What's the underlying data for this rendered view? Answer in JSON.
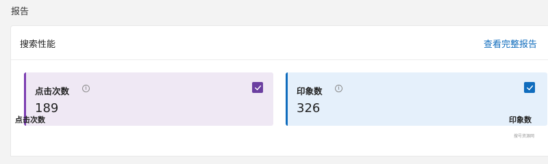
{
  "section": {
    "title": "报告"
  },
  "card": {
    "title": "搜索性能",
    "link_label": "查看完整报告"
  },
  "metrics": [
    {
      "label": "点击次数",
      "value": "189",
      "checked": true,
      "color": "#7a3bb0"
    },
    {
      "label": "印象数",
      "value": "326",
      "checked": true,
      "color": "#0f6cbd"
    }
  ],
  "chart": {
    "left_axis_label": "点击次数",
    "right_axis_label": "印象数"
  },
  "watermark": "搜号资源网",
  "info_icon_glyph": "i"
}
